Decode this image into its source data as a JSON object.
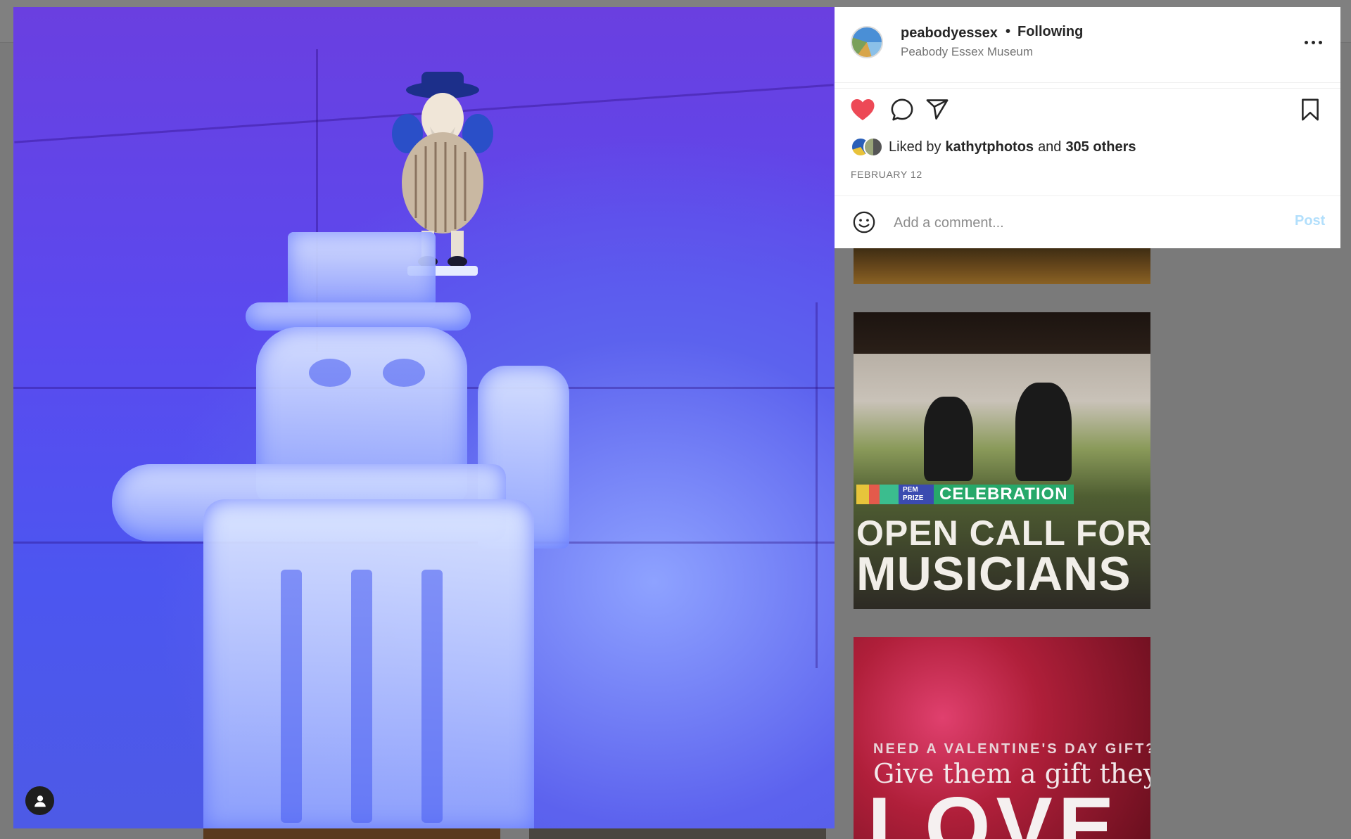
{
  "post": {
    "username": "peabodyessex",
    "separator": "•",
    "follow_status": "Following",
    "location": "Peabody Essex Museum",
    "liked_by_prefix": "Liked by",
    "liked_by_user": "kathytphotos",
    "liked_by_and": "and",
    "liked_by_others": "305 others",
    "date": "FEBRUARY 12",
    "liked": true,
    "icons": [
      "heart-filled-icon",
      "comment-icon",
      "share-icon",
      "bookmark-icon",
      "more-options-icon",
      "emoji-icon",
      "user-icon"
    ]
  },
  "comment": {
    "placeholder": "Add a comment...",
    "post_label": "Post"
  },
  "background_tiles": {
    "music": {
      "badge": "PEM PRIZE",
      "label": "CELEBRATION",
      "headline_line1": "OPEN CALL FOR",
      "headline_line2": "MUSICIANS"
    },
    "valentine": {
      "kicker": "NEED A VALENTINE'S DAY GIFT?",
      "line2": "Give them a gift they'll",
      "big": "LOVE"
    }
  },
  "colors": {
    "like_red": "#ed4956",
    "post_disabled": "#b2dffc",
    "text_primary": "#262626",
    "text_secondary": "#737373"
  }
}
